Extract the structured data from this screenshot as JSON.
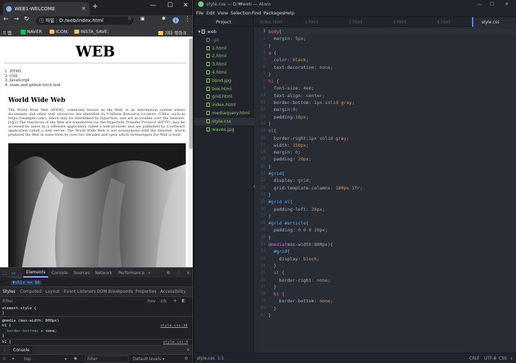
{
  "browser": {
    "tab_title": "WEB1-WELCOME",
    "new_tab": "+",
    "url": "D:/web/index.html",
    "url_prefix": "파일",
    "bookmarks": [
      "앱",
      "NAVER",
      "ICON;",
      "INSTA_SAVE;",
      "기타 북마크"
    ],
    "window_controls": [
      "—",
      "☐",
      "✕"
    ]
  },
  "webpage": {
    "heading": "WEB",
    "list": [
      "1. HTML",
      "2. CSS",
      "3. JavaScript",
      "4. atom and github fetch test"
    ],
    "subheading": "World Wide Web",
    "paragraph": "The World Wide Web (WWW), commonly known as the Web, is an information system where documents and other web resources are identified by Uniform Resource Locators (URLs, such as https://example.com/), which may be interlinked by hypertext, and are accessible over the Internet.[1][2] The resources of the Web are transferred via the Hypertext Transfer Protocol (HTTP), may be accessed by users by a software application called a web browser, and are published by a software application called a web server. The World Wide Web is not synonymous with the Internet, which predated the Web in some form by over two decades and upon which technologies the Web is built."
  },
  "devtools": {
    "tabs": [
      "Elements",
      "Console",
      "Sources",
      "Network",
      "Performance",
      "»"
    ],
    "element_path": "▼<h1> == $0",
    "body_crumb": "</body>",
    "style_tabs": [
      "Styles",
      "Computed",
      "Layout",
      "Event Listeners",
      "DOM Breakpoints",
      "Properties",
      "Accessibility"
    ],
    "filter_placeholder": "Filter",
    "filter_hov": ":hov",
    "filter_cls": ".cls",
    "element_style": "element.style {",
    "close_brace": "}",
    "media_rule": "@media (max-width: 800px)",
    "media_selector": "h1 {",
    "media_prop": "border-bottom",
    "media_val": "none;",
    "source1": "style.css:38",
    "next_selector": "h1 {",
    "source2": "style.css:8",
    "console_label": "Console",
    "console_context": "top",
    "console_filter": "Filter",
    "console_levels": "Default levels ▾"
  },
  "atom": {
    "title": "style.css — D:₩web — Atom",
    "menu": [
      "File",
      "Edit",
      "View",
      "Selection",
      "Find",
      "Packages",
      "Help"
    ],
    "project_label": "Project",
    "tree": [
      {
        "name": "web",
        "kind": "dir"
      },
      {
        "name": ".git",
        "kind": "git"
      },
      {
        "name": "1.html",
        "kind": "file"
      },
      {
        "name": "2.html",
        "kind": "file"
      },
      {
        "name": "3.html",
        "kind": "file"
      },
      {
        "name": "4.html",
        "kind": "file"
      },
      {
        "name": "blind.jpg",
        "kind": "file"
      },
      {
        "name": "box.html",
        "kind": "file"
      },
      {
        "name": "grid.html",
        "kind": "file"
      },
      {
        "name": "index.html",
        "kind": "file"
      },
      {
        "name": "mediaquery.html",
        "kind": "file"
      },
      {
        "name": "style.css",
        "kind": "file"
      },
      {
        "name": "waves.jpg",
        "kind": "file"
      }
    ],
    "tabs": [
      "index.html",
      "1.html",
      "2.html",
      "3.html",
      "4.html",
      "style.css"
    ],
    "status_file": "style.css",
    "status_pos": "1:1",
    "status_right": [
      "CRLF",
      "UTF-8",
      "CSS",
      "↓"
    ]
  },
  "code_lines": [
    "body{",
    "  margin: 5px;",
    "}",
    "a {",
    "  color: black;",
    "  text-decoration: none;",
    "}",
    "h1 {",
    "  font-size: 4em;",
    "  text-align: center;",
    "  border-bottom: 1px solid gray;",
    "  margin:0;",
    "  padding:16px;",
    "}",
    "ol{",
    "  border-right:1px solid gray;",
    "  width: 150px;",
    "  margin: 0;",
    "  padding: 20px;",
    "}",
    "#grid{",
    "  display: grid;",
    "  grid-template-columns: 180px 1fr;",
    "}",
    "#grid ol{",
    "  padding-left: 20px;",
    "}",
    "#grid #article{",
    "  padding: 0 0 0 20px;",
    "}",
    "@media(max-width:800px){",
    "  #grid{",
    "    display: block;",
    "  }",
    "  ol {",
    "    border-right: none;",
    "  }",
    "  h1 {",
    "    border-bottom: none;",
    "  }",
    "}"
  ],
  "colors": {
    "atom_bg": "#282c34",
    "selector": "#e06c75",
    "value": "#d19a66",
    "keyword": "#c678dd",
    "id": "#61afef",
    "tree_file": "#98c379"
  }
}
